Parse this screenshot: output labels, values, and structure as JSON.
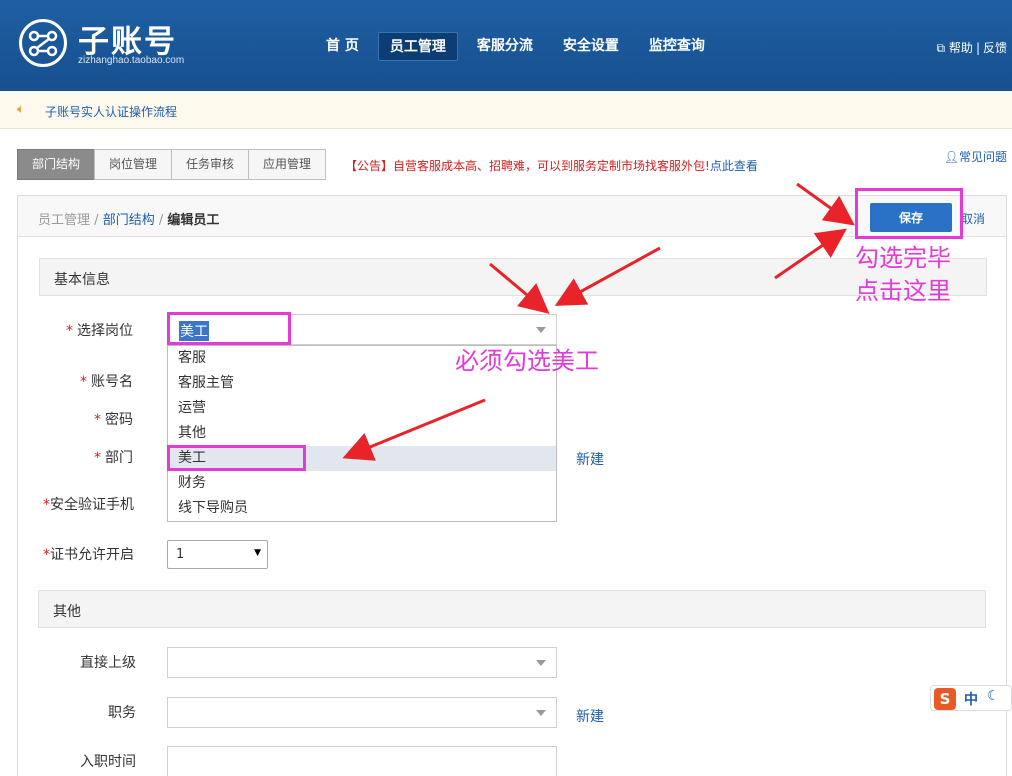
{
  "header": {
    "logo_title": "子账号",
    "logo_subtitle": "zizhanghao.taobao.com",
    "nav": [
      {
        "label": "首 页"
      },
      {
        "label": "员工管理"
      },
      {
        "label": "客服分流"
      },
      {
        "label": "安全设置"
      },
      {
        "label": "监控查询"
      }
    ],
    "help_label": "帮助",
    "feedback_label": "反馈"
  },
  "notice": {
    "text": "子账号实人认证操作流程"
  },
  "tabs": [
    {
      "label": "部门结构"
    },
    {
      "label": "岗位管理"
    },
    {
      "label": "任务审核"
    },
    {
      "label": "应用管理"
    }
  ],
  "announcement": {
    "text": "【公告】自营客服成本高、招聘难，可以到服务定制市场找客服外包!",
    "link": "点此查看"
  },
  "faq_label": "常见问题",
  "breadcrumb": {
    "item1": "员工管理",
    "sep": "/",
    "item2": "部门结构",
    "item3": "编辑员工"
  },
  "actions": {
    "save": "保存",
    "cancel": "取消"
  },
  "sections": {
    "basic": "基本信息",
    "other": "其他"
  },
  "form": {
    "position_label": "选择岗位",
    "position_value": "美工",
    "account_label": "账号名",
    "password_label": "密码",
    "dept_label": "部门",
    "phone_label": "安全验证手机",
    "cert_label": "证书允许开启",
    "cert_value": "1",
    "supervisor_label": "直接上级",
    "duty_label": "职务",
    "join_label": "入职时间",
    "new_label": "新建",
    "required_mark": "*"
  },
  "dropdown_options": [
    "客服",
    "客服主管",
    "运营",
    "其他",
    "美工",
    "财务",
    "线下导购员"
  ],
  "annotations": {
    "must_check": "必须勾选美工",
    "click_here_1": "勾选完毕",
    "click_here_2": "点击这里"
  },
  "ime": {
    "logo": "S",
    "lang": "中",
    "moon": "☾"
  },
  "colors": {
    "header_blue": "#1e5fa3",
    "link_blue": "#1d5eab",
    "annotation_magenta": "#e33bd8",
    "arrow_red": "#e8232a",
    "save_blue": "#2a72c6"
  }
}
